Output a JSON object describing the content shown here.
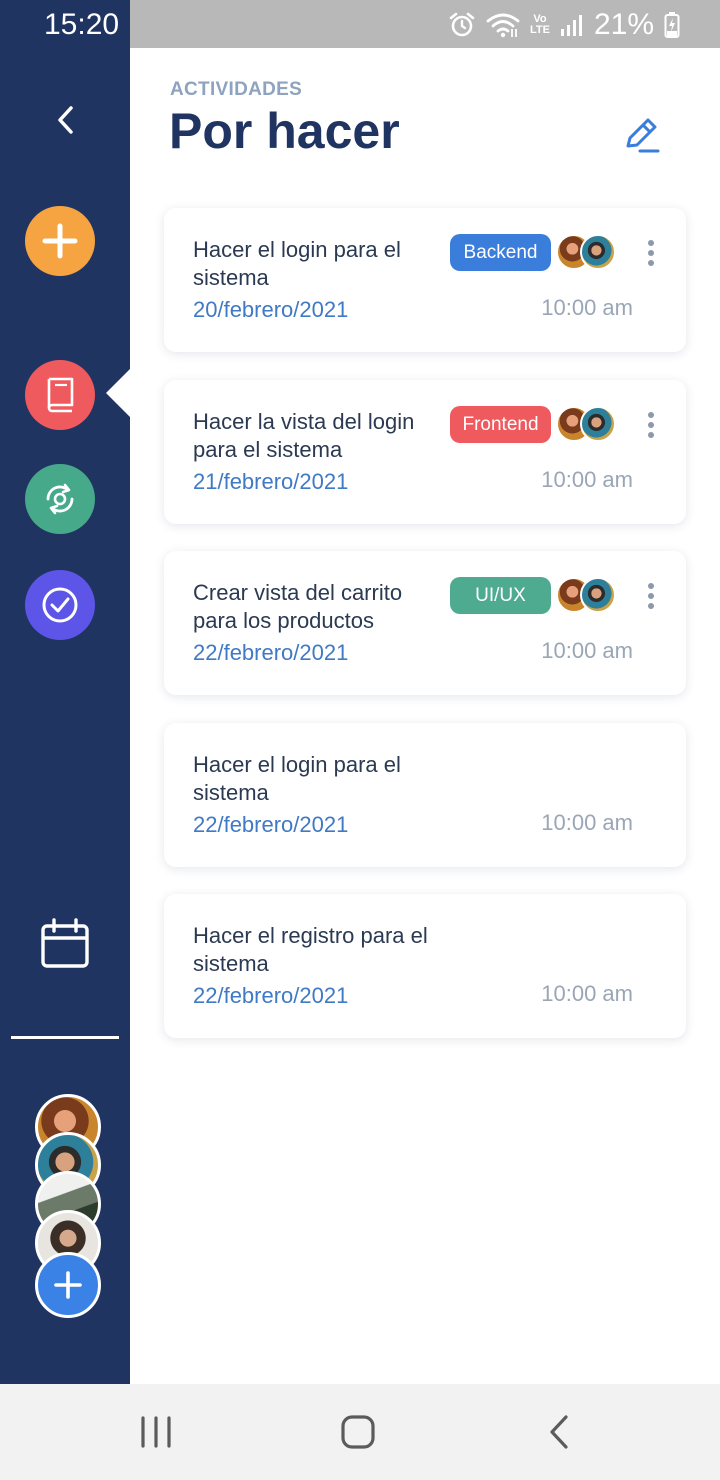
{
  "status_bar": {
    "time": "15:20",
    "battery_percent": "21%",
    "icons": [
      "alarm-icon",
      "wifi-icon",
      "volte-icon",
      "signal-icon",
      "battery-charging-icon"
    ],
    "lte_label": "LTE",
    "vo_label": "Vo"
  },
  "sidebar": {
    "background": "#1f3461",
    "back_icon": "chevron-left-icon",
    "buttons": [
      {
        "name": "add",
        "icon": "plus-icon",
        "color": "#f6a341"
      },
      {
        "name": "todo",
        "icon": "book-icon",
        "color": "#ef5a5f",
        "active": true
      },
      {
        "name": "in-progress",
        "icon": "sync-icon",
        "color": "#46a98a"
      },
      {
        "name": "done",
        "icon": "check-circle-icon",
        "color": "#5d54e8"
      }
    ],
    "calendar_icon": "calendar-icon",
    "members": [
      "avatar-1",
      "avatar-2",
      "avatar-3",
      "avatar-4"
    ],
    "add_member_icon": "plus-icon"
  },
  "header": {
    "subtitle": "ACTIVIDADES",
    "title": "Por hacer",
    "edit_icon": "pencil-icon"
  },
  "tasks": [
    {
      "title": "Hacer el login para el sistema",
      "date": "20/febrero/2021",
      "time": "10:00 am",
      "tag": "Backend",
      "tag_color": "#3b7ddb",
      "has_members": true
    },
    {
      "title": "Hacer la vista del login para el sistema",
      "date": "21/febrero/2021",
      "time": "10:00 am",
      "tag": "Frontend",
      "tag_color": "#ef5a5f",
      "has_members": true
    },
    {
      "title": "Crear vista del carrito para los productos",
      "date": "22/febrero/2021",
      "time": "10:00 am",
      "tag": "UI/UX",
      "tag_color": "#4eab8f",
      "has_members": true
    },
    {
      "title": "Hacer el login para el sistema",
      "date": "22/febrero/2021",
      "time": "10:00 am",
      "tag": "",
      "has_members": false
    },
    {
      "title": "Hacer el registro para el sistema",
      "date": "22/febrero/2021",
      "time": "10:00 am",
      "tag": "",
      "has_members": false
    }
  ],
  "navbar": {
    "icons": [
      "recent-apps-icon",
      "home-icon",
      "back-icon"
    ]
  }
}
